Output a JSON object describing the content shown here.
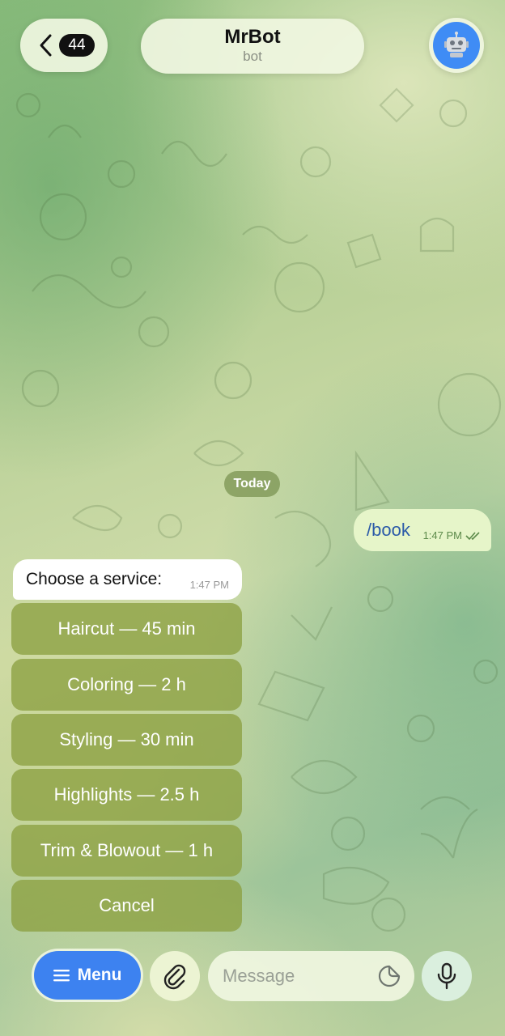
{
  "header": {
    "unread_count": "44",
    "title": "MrBot",
    "subtitle": "bot",
    "avatar_icon": "robot-icon",
    "avatar_color": "#3f8cf5"
  },
  "chat": {
    "date_separator": "Today",
    "outgoing": {
      "text": "/book",
      "time": "1:47 PM"
    },
    "incoming": {
      "text": "Choose a service:",
      "time": "1:47 PM"
    },
    "keyboard": [
      {
        "label": "Haircut — 45 min"
      },
      {
        "label": "Coloring — 2 h"
      },
      {
        "label": "Styling — 30 min"
      },
      {
        "label": "Highlights — 2.5 h"
      },
      {
        "label": "Trim & Blowout — 1 h"
      },
      {
        "label": "Cancel"
      }
    ]
  },
  "composer": {
    "menu_label": "Menu",
    "message_placeholder": "Message",
    "menu_color": "#3d82f0"
  }
}
